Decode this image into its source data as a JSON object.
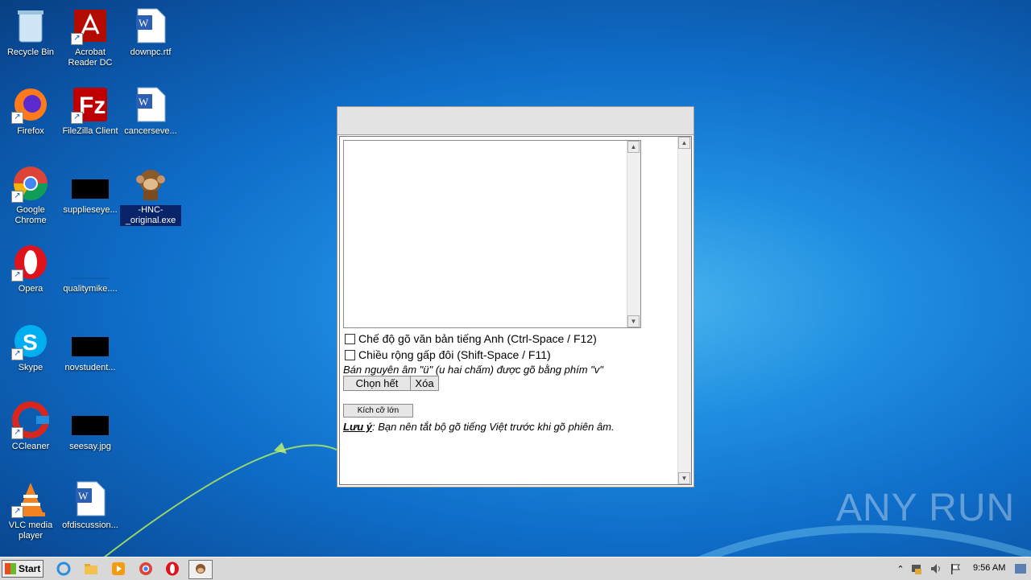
{
  "desktop": {
    "icons": [
      {
        "label": "Recycle Bin",
        "name": "recycle-bin-icon"
      },
      {
        "label": "Acrobat Reader DC",
        "name": "acrobat-icon"
      },
      {
        "label": "downpc.rtf",
        "name": "word-doc-icon"
      },
      {
        "label": "Firefox",
        "name": "firefox-icon"
      },
      {
        "label": "FileZilla Client",
        "name": "filezilla-icon"
      },
      {
        "label": "cancerseve...",
        "name": "word-doc-icon"
      },
      {
        "label": "Google Chrome",
        "name": "chrome-icon"
      },
      {
        "label": "supplieseye...",
        "name": "black-thumbnail-icon"
      },
      {
        "label": "-HNC-_original.exe",
        "name": "monkey-exe-icon"
      },
      {
        "label": "Opera",
        "name": "opera-icon"
      },
      {
        "label": "qualitymike....",
        "name": "blank-file-icon"
      },
      {
        "label": "Skype",
        "name": "skype-icon"
      },
      {
        "label": "novstudent...",
        "name": "black-thumbnail-icon"
      },
      {
        "label": "CCleaner",
        "name": "ccleaner-icon"
      },
      {
        "label": "seesay.jpg",
        "name": "black-thumbnail-icon"
      },
      {
        "label": "VLC media player",
        "name": "vlc-icon"
      },
      {
        "label": "ofdiscussion...",
        "name": "word-doc-icon"
      }
    ]
  },
  "window": {
    "checkbox_english": "Chế độ gõ văn bản tiếng Anh (Ctrl-Space / F12)",
    "checkbox_double": "Chiều rộng gấp đôi (Shift-Space / F11)",
    "hint": "Bán nguyên âm \"ü\" (u hai chấm) được gõ bằng phím \"v\"",
    "btn_select_all": "Chọn hết",
    "btn_delete": "Xóa",
    "btn_large": "Kích cỡ lớn",
    "note_label": "Lưu ý",
    "note_text": ": Bạn nên tắt bộ gõ tiếng Việt trước khi gõ phiên âm."
  },
  "taskbar": {
    "start_label": "Start",
    "clock": "9:56 AM"
  },
  "watermark": "ANY RUN"
}
